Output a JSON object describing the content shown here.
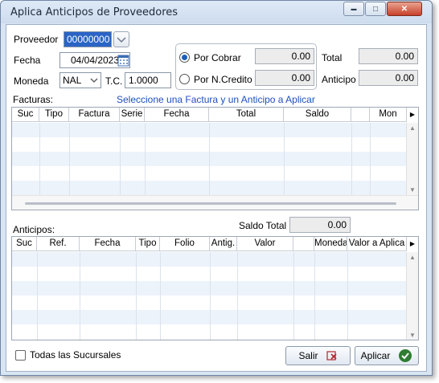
{
  "window": {
    "title": "Aplica Anticipos de Proveedores",
    "minimize": "▬",
    "maximize": "□",
    "close": "✕"
  },
  "form": {
    "proveedor_label": "Proveedor",
    "proveedor_value": "00000000",
    "fecha_label": "Fecha",
    "fecha_value": "04/04/2023",
    "moneda_label": "Moneda",
    "moneda_value": "NAL",
    "tc_label": "T.C.",
    "tc_value": "1.0000",
    "por_cobrar_label": "Por Cobrar",
    "por_cobrar_value": "0.00",
    "por_ncredito_label": "Por N.Credito",
    "por_ncredito_value": "0.00",
    "total_label": "Total",
    "total_value": "0.00",
    "anticipo_label": "Anticipo",
    "anticipo_value": "0.00"
  },
  "facturas": {
    "label": "Facturas:",
    "hint": "Seleccione una Factura y un Anticipo a Aplicar",
    "columns": [
      "Suc",
      "Tipo",
      "Factura",
      "Serie",
      "Fecha",
      "Total",
      "Saldo",
      "",
      "Mon"
    ]
  },
  "anticipos": {
    "label": "Anticipos:",
    "saldo_total_label": "Saldo Total",
    "saldo_total_value": "0.00",
    "columns": [
      "Suc",
      "Ref.",
      "Fecha",
      "Tipo",
      "Folio",
      "Antig.",
      "Valor",
      "",
      "Moneda",
      "Valor a Aplica"
    ]
  },
  "footer": {
    "todas_sucursales_label": "Todas las Sucursales",
    "salir_label": "Salir",
    "aplicar_label": "Aplicar"
  },
  "colors": {
    "accent": "#1a5fbf",
    "hint_text": "#1f4fbf",
    "apply_icon": "#2e7d32",
    "exit_icon": "#b3262b"
  },
  "icons": {
    "dropdown": "chevron-down-icon",
    "calendar": "calendar-icon",
    "apply": "check-icon",
    "exit": "close-icon"
  }
}
